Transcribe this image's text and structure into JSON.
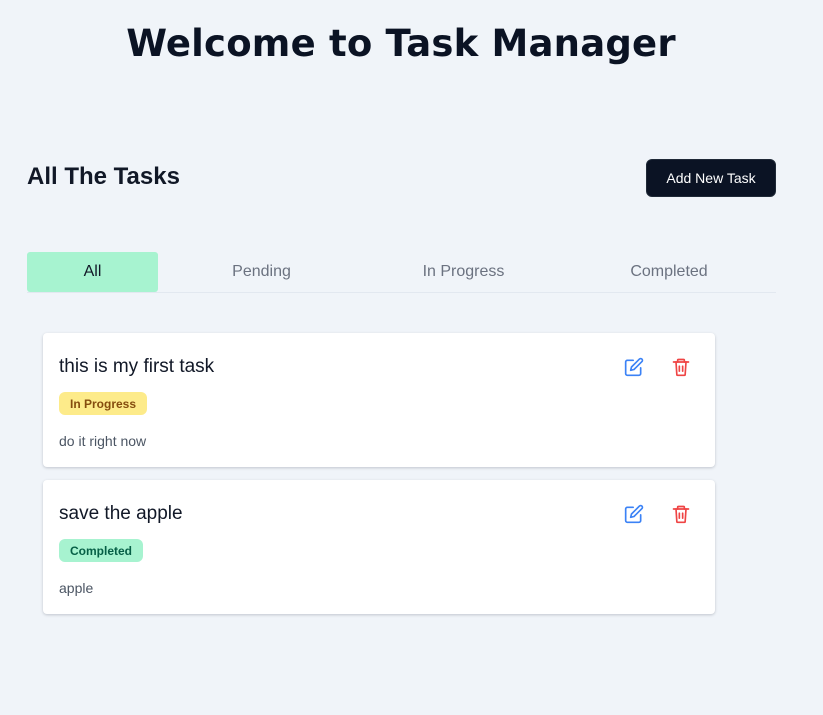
{
  "header": {
    "title": "Welcome to Task Manager"
  },
  "section": {
    "title": "All The Tasks",
    "add_button_label": "Add New Task"
  },
  "tabs": [
    {
      "label": "All",
      "active": true
    },
    {
      "label": "Pending",
      "active": false
    },
    {
      "label": "In Progress",
      "active": false
    },
    {
      "label": "Completed",
      "active": false
    }
  ],
  "tasks": [
    {
      "title": "this is my first task",
      "status": "In Progress",
      "description": "do it right now"
    },
    {
      "title": "save the apple",
      "status": "Completed",
      "description": "apple"
    }
  ],
  "icons": {
    "edit": "edit-icon",
    "delete": "trash-icon"
  },
  "colors": {
    "background": "#f0f4f9",
    "primary_button": "#0b1324",
    "active_tab": "#a7f3d0",
    "badge_in_progress": "#fdeb8a",
    "badge_completed": "#a7f3d0",
    "edit_icon": "#3b82f6",
    "delete_icon": "#ef4444"
  }
}
